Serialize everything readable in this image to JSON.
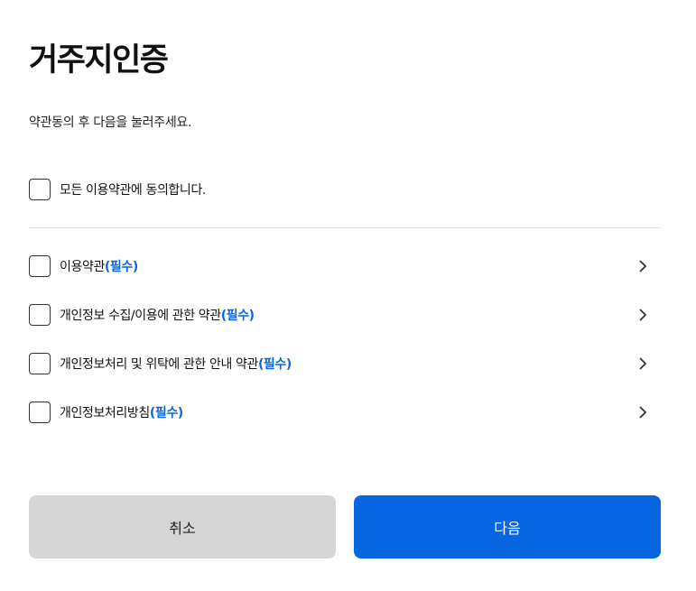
{
  "header": {
    "title": "거주지인증",
    "subtitle": "약관동의 후 다음을 눌러주세요."
  },
  "agree_all": {
    "label": "모든 이용약관에 동의합니다."
  },
  "terms": [
    {
      "label": "이용약관",
      "required_tag": "(필수)"
    },
    {
      "label": "개인정보 수집/이용에 관한 약관",
      "required_tag": "(필수)"
    },
    {
      "label": "개인정보처리 및 위탁에 관한 안내 약관",
      "required_tag": "(필수)"
    },
    {
      "label": "개인정보처리방침",
      "required_tag": "(필수)"
    }
  ],
  "buttons": {
    "cancel_label": "취소",
    "next_label": "다음"
  },
  "colors": {
    "accent": "#0866e3",
    "cancel_bg": "#d6d6d6"
  }
}
